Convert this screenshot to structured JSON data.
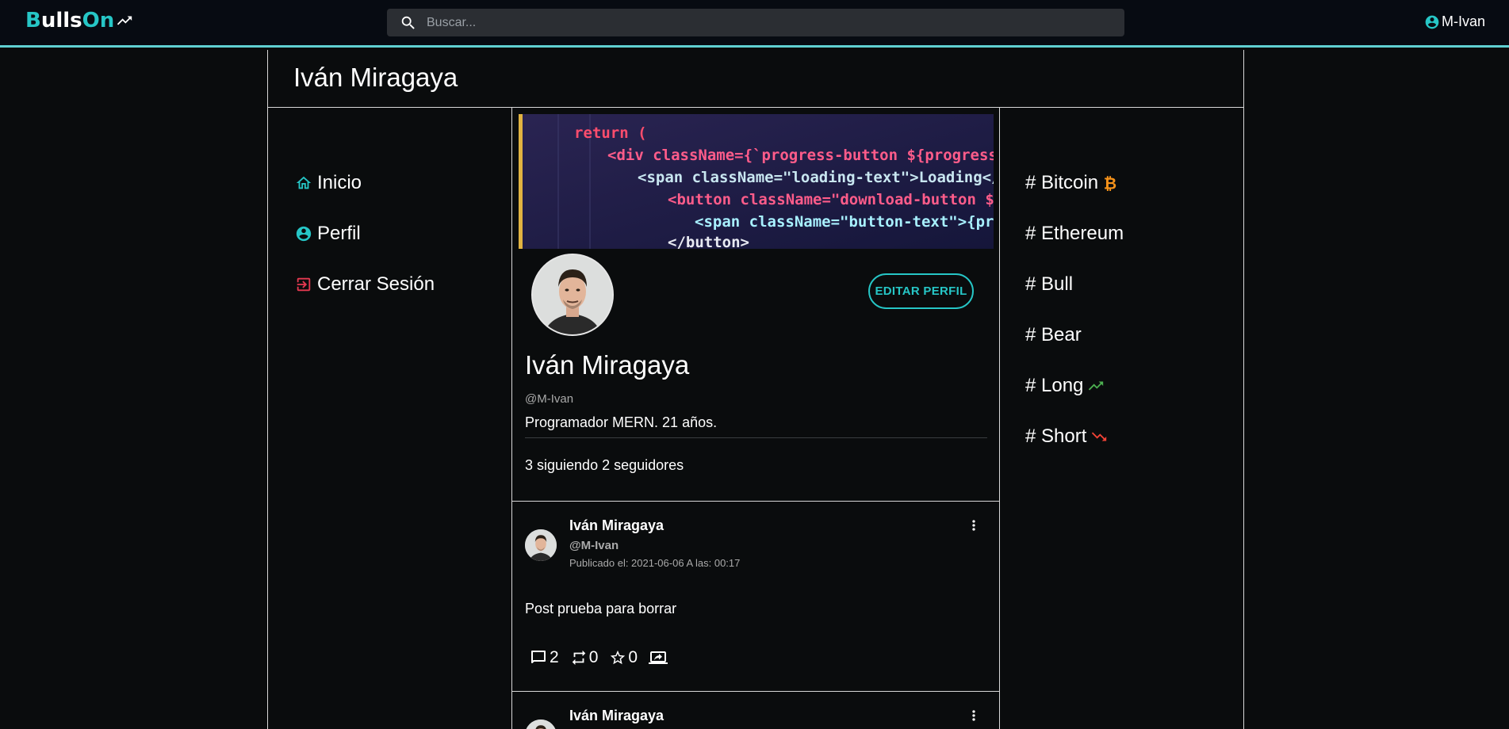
{
  "topbar": {
    "logo_letter": "B",
    "logo_mid": "ulls",
    "logo_end": "On",
    "search_placeholder": "Buscar...",
    "username": "M-Ivan"
  },
  "page": {
    "title": "Iván Miragaya"
  },
  "left_nav": [
    {
      "label": "Inicio",
      "icon": "home-icon"
    },
    {
      "label": "Perfil",
      "icon": "user-circle-icon"
    },
    {
      "label": "Cerrar Sesión",
      "icon": "logout-icon"
    }
  ],
  "profile": {
    "edit_label": "EDITAR PERFIL",
    "name": "Iván Miragaya",
    "handle": "@M-Ivan",
    "bio": "Programador MERN. 21 años.",
    "follow_text": "3 siguiendo 2 seguidores"
  },
  "banner_code": [
    "return (",
    "<div className={`progress-button ${progress",
    "<span className=\"loading-text\">Loading</span>",
    "<button className=\"download-button ${active",
    "<span className=\"button-text\">{progress",
    "</button>"
  ],
  "posts": [
    {
      "name": "Iván Miragaya",
      "handle": "@M-Ivan",
      "date": "Publicado el: 2021-06-06 A las: 00:17",
      "text": "Post prueba para borrar",
      "comments": "2",
      "retweets": "0",
      "stars": "0"
    },
    {
      "name": "Iván Miragaya"
    }
  ],
  "right_tags": [
    {
      "label": "# Bitcoin",
      "icon": "bitcoin-icon",
      "color": "#f7931a"
    },
    {
      "label": "# Ethereum"
    },
    {
      "label": "# Bull"
    },
    {
      "label": "# Bear"
    },
    {
      "label": "# Long",
      "icon": "trending-up-icon",
      "color": "#4caf50"
    },
    {
      "label": "# Short",
      "icon": "trending-down-icon",
      "color": "#f44336"
    }
  ],
  "colors": {
    "accent": "#26c6c6",
    "topbar_border": "#5fd0d2",
    "logout": "#e53950"
  }
}
